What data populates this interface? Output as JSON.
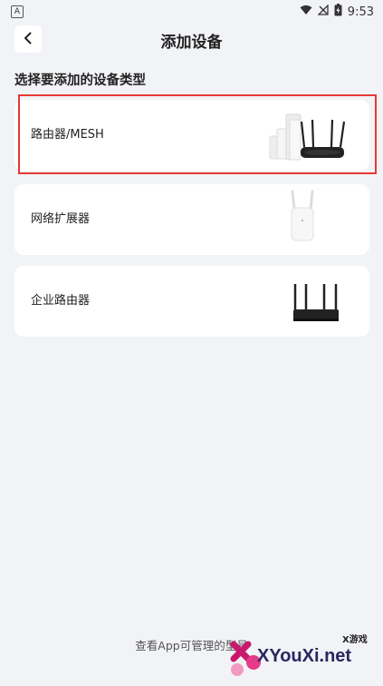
{
  "status": {
    "left_badge": "A",
    "time": "9:53"
  },
  "header": {
    "title": "添加设备"
  },
  "section": {
    "label": "选择要添加的设备类型"
  },
  "devices": [
    {
      "label": "路由器/MESH",
      "image": "mesh-router-image"
    },
    {
      "label": "网络扩展器",
      "image": "range-extender-image"
    },
    {
      "label": "企业路由器",
      "image": "enterprise-router-image"
    }
  ],
  "footer": {
    "text": "查看App可管理的型号"
  },
  "watermark": {
    "small": "X游戏",
    "site": "XYouXi.net"
  },
  "colors": {
    "background": "#f2f3f6",
    "card": "#ffffff",
    "highlight": "#e53935"
  }
}
